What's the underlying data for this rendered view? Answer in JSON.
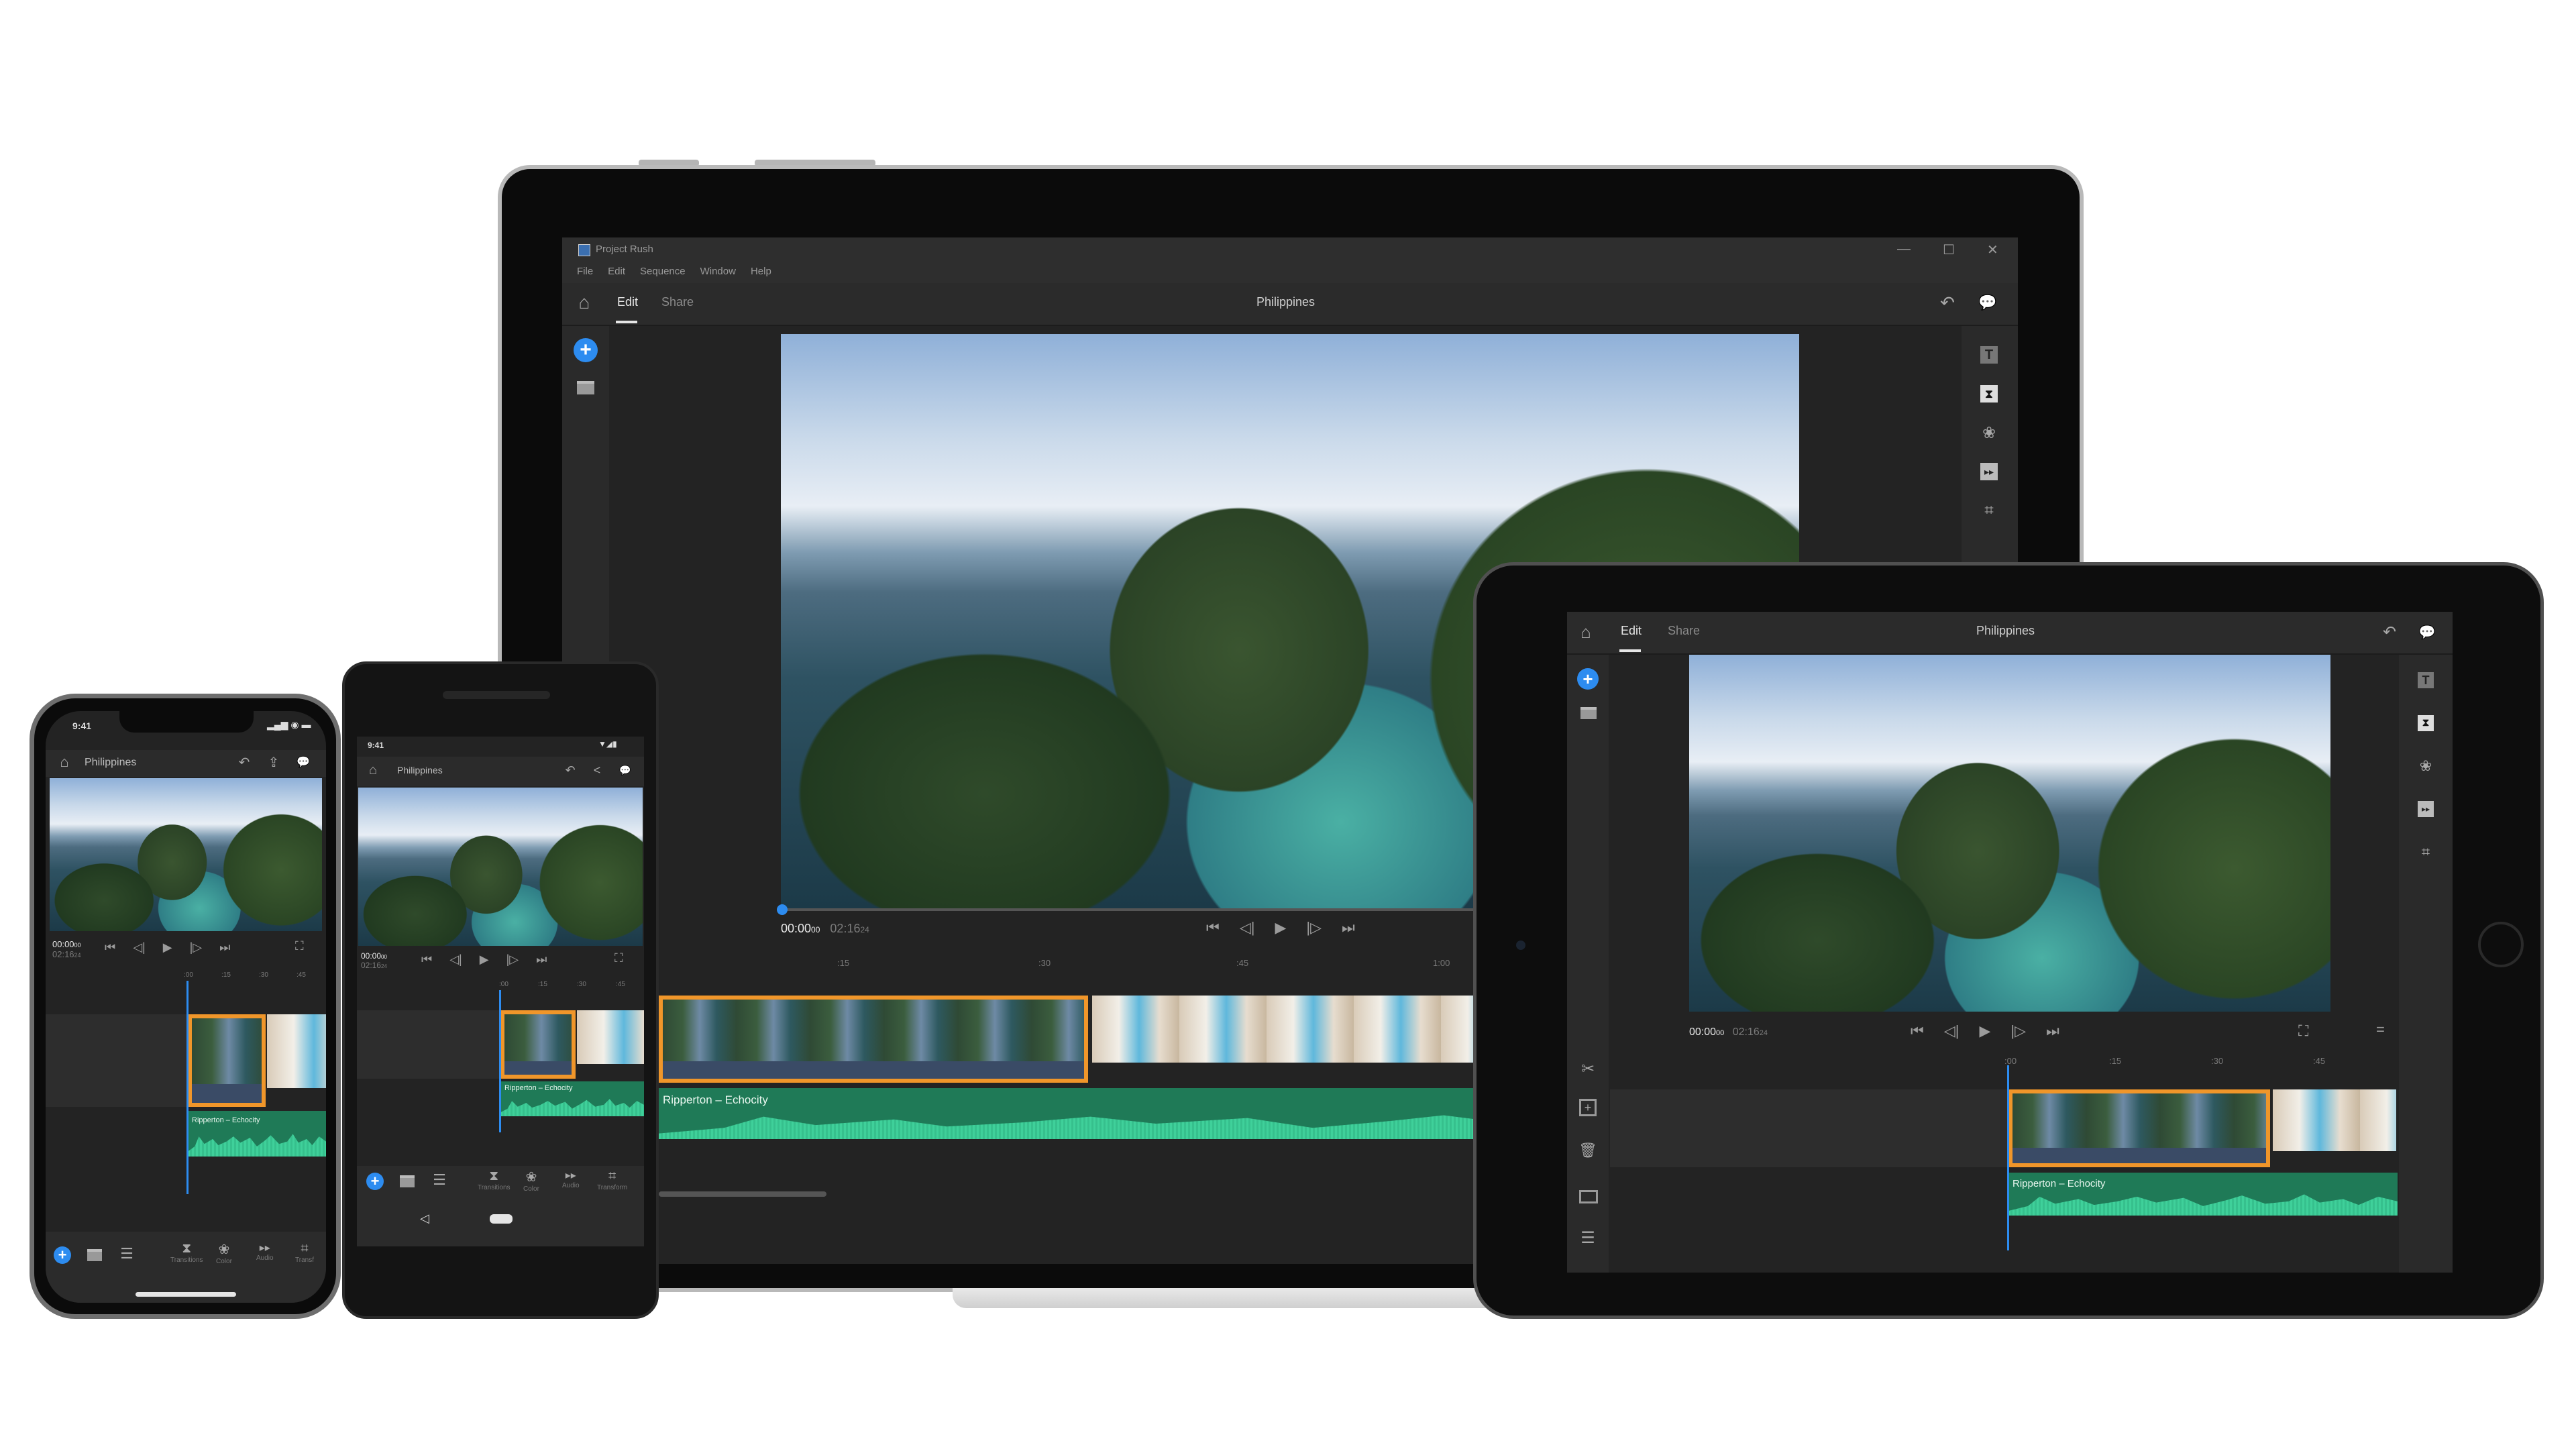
{
  "laptop": {
    "window_title": "Project Rush",
    "window_controls": {
      "minimize": "—",
      "maximize": "☐",
      "close": "✕"
    },
    "menu": [
      "File",
      "Edit",
      "Sequence",
      "Window",
      "Help"
    ],
    "tabs": [
      {
        "label": "Edit",
        "active": true
      },
      {
        "label": "Share",
        "active": false
      }
    ],
    "project_title": "Philippines",
    "left_rail": [
      "add-media",
      "project-assets"
    ],
    "right_rail": [
      "titles",
      "transitions",
      "color",
      "audio",
      "transform"
    ],
    "playback": {
      "current": "00:00",
      "current_frames": "00",
      "duration": "02:16",
      "duration_frames": "24",
      "progress": 0
    },
    "ruler": [
      ":15",
      ":30",
      ":45",
      "1:00"
    ],
    "audio_clip_label": "Ripperton – Echocity"
  },
  "tablet": {
    "tabs": [
      {
        "label": "Edit",
        "active": true
      },
      {
        "label": "Share",
        "active": false
      }
    ],
    "project_title": "Philippines",
    "playback": {
      "current": "00:00",
      "current_frames": "00",
      "duration": "02:16",
      "duration_frames": "24"
    },
    "ruler": [
      ":00",
      ":15",
      ":30",
      ":45"
    ],
    "left_tools": [
      "split",
      "duplicate",
      "delete",
      "extract",
      "track-list",
      "add-selection"
    ],
    "audio_clip_label": "Ripperton – Echocity"
  },
  "iphone": {
    "time": "9:41",
    "project_title": "Philippines",
    "playback": {
      "current": "00:00",
      "current_frames": "00",
      "duration": "02:16",
      "duration_frames": "24"
    },
    "ruler": [
      ":00",
      ":15",
      ":30",
      ":45"
    ],
    "audio_clip_label": "Ripperton – Echocity",
    "bottom_tools": [
      "Transitions",
      "Color",
      "Audio",
      "Transf"
    ]
  },
  "pixel": {
    "time": "9:41",
    "project_title": "Philippines",
    "playback": {
      "current": "00:00",
      "current_frames": "00",
      "duration": "02:16",
      "duration_frames": "24"
    },
    "ruler": [
      ":00",
      ":15",
      ":30",
      ":45"
    ],
    "audio_clip_label": "Ripperton – Echocity",
    "bottom_tools": [
      "Transitions",
      "Color",
      "Audio",
      "Transform"
    ]
  },
  "icons": {
    "home": "⌂",
    "undo": "↶",
    "comment": "💬",
    "plus": "+",
    "archive": "▭",
    "skip_start": "⏮",
    "step_back": "◁|",
    "play": "▶",
    "step_fwd": "|▷",
    "skip_end": "⏭",
    "fullscreen": "⛶",
    "share": "⇪",
    "scissors": "✂",
    "trash": "🗑",
    "list": "☰",
    "back": "◁"
  },
  "colors": {
    "accent": "#2d8cf0",
    "selection": "#f0962a",
    "audio": "#1f7a57",
    "audio_wave": "#3fd09a"
  }
}
